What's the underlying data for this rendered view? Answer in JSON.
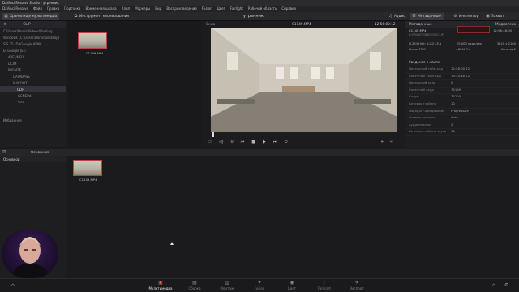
{
  "window": {
    "title": "DaVinci Resolve Studio - утренник"
  },
  "menu": [
    "DaVinci Resolve",
    "Файл",
    "Правка",
    "Подгонка",
    "Временная шкала",
    "Клип",
    "Маркеры",
    "Вид",
    "Воспроизведение",
    "Fusion",
    "Цвет",
    "Fairlight",
    "Рабочий область",
    "Справка"
  ],
  "toolbar": {
    "media_pool_label": "Хранилище мультимедиа",
    "effects_label": "Инструмент клонирования",
    "project_name": "утренник",
    "audio_label": "Аудио",
    "metadata_label": "Метаданные",
    "inspector_label": "Инспектор",
    "scroll_label": "Захват"
  },
  "left_panel": {
    "bin_label": "CLIP",
    "tree": [
      "C:\\Users\\Denis\\Videos\\Dealing...",
      "Windows (C:\\Users\\Denis\\Desktop)",
      "SIS 75 (D:\\Google ADM)",
      "ECGoogle (E:)",
      "AVF_INFO",
      "DCIM",
      "PRIVATE",
      "DATABASE",
      "M4ROOT",
      "CLIP",
      "GENERAL",
      "SUB"
    ],
    "selected_item": "CLIP",
    "favorites_label": "Избранное"
  },
  "browser_clip": {
    "name": "C1149.MP4"
  },
  "viewer": {
    "zoom_label": "Окно",
    "clip_name": "C1149.MP4",
    "timecode": "12:56:00:12",
    "transport": {
      "jog": "0",
      "speed": "1"
    }
  },
  "metadata": {
    "header": "Метаданные",
    "media_label": "Медиатека",
    "clip_title": "C1149.MP4",
    "path": "E:\\PRIVATE\\M4ROOT\\CLIP",
    "timecode": "12:56:48:00",
    "video_codec": "H.264 High 4:2:2 L5.1",
    "fps": "25.000 кадр/сек",
    "resolution": "3840 x 2160",
    "audio_codec": "Linear PCM",
    "sample_rate": "48000 Гц",
    "channels": "Каналы 2",
    "section": "Сведения о клипе",
    "rows": [
      {
        "k": "Начальный тайм-код",
        "v": "12:56:00:12"
      },
      {
        "k": "Конечный тайм-код",
        "v": "13:44:48:12"
      },
      {
        "k": "Начальный кадр",
        "v": "0"
      },
      {
        "k": "Конечный кадр",
        "v": "75199"
      },
      {
        "k": "Кадры",
        "v": "75200"
      },
      {
        "k": "Битовая глубина",
        "v": "10"
      },
      {
        "k": "Порядок чередования",
        "v": "Progressive"
      },
      {
        "k": "Уровень данных",
        "v": "Auto"
      },
      {
        "k": "Аудиоканалы",
        "v": "2"
      },
      {
        "k": "Битовая глубина звука",
        "v": "16"
      }
    ]
  },
  "media_pool": {
    "master_label": "Основной",
    "tree_item": "Основной",
    "clip": {
      "name": "C1149.MP4"
    }
  },
  "pages": [
    {
      "label": "Мультимедиа",
      "icon": "media-icon"
    },
    {
      "label": "Сборка",
      "icon": "cut-icon"
    },
    {
      "label": "Монтаж",
      "icon": "edit-icon"
    },
    {
      "label": "Fusion",
      "icon": "fusion-icon"
    },
    {
      "label": "Цвет",
      "icon": "color-icon"
    },
    {
      "label": "Fairlight",
      "icon": "fairlight-icon"
    },
    {
      "label": "Экспорт",
      "icon": "deliver-icon"
    }
  ],
  "active_page": "Мультимедиа",
  "accent_color": "#e0604a",
  "clip_outline_color": "#bb4444"
}
